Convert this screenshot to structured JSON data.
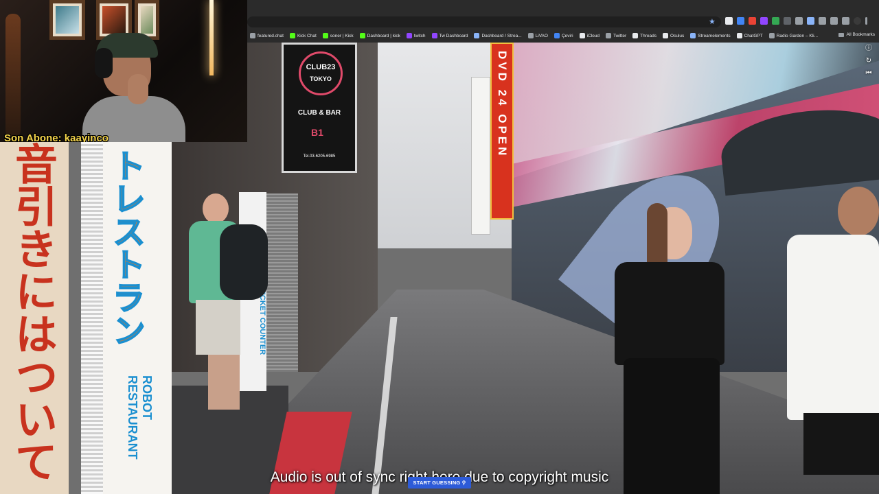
{
  "webcam": {
    "caption": "Son Abone: kaayinco"
  },
  "bookmarks": [
    {
      "label": "featured.chat",
      "color": "#9aa0a6"
    },
    {
      "label": "Kick Chat",
      "color": "#53fc18"
    },
    {
      "label": "soner | Kick",
      "color": "#53fc18"
    },
    {
      "label": "Dashboard | kick",
      "color": "#53fc18"
    },
    {
      "label": "twitch",
      "color": "#9146ff"
    },
    {
      "label": "Tw Dashboard",
      "color": "#9146ff"
    },
    {
      "label": "Dashboard / Strea...",
      "color": "#8ab4f8"
    },
    {
      "label": "LiVAO",
      "color": "#9aa0a6"
    },
    {
      "label": "Çeviri",
      "color": "#4285f4"
    },
    {
      "label": "iCloud",
      "color": "#e8eaed"
    },
    {
      "label": "Twitter",
      "color": "#9aa0a6"
    },
    {
      "label": "Threads",
      "color": "#e8eaed"
    },
    {
      "label": "Oculus",
      "color": "#e8eaed"
    },
    {
      "label": "Streamelements",
      "color": "#8ab4f8"
    },
    {
      "label": "ChatGPT",
      "color": "#e8eaed"
    },
    {
      "label": "Radio Garden – Kli...",
      "color": "#9aa0a6"
    }
  ],
  "bookmarks_all": "All Bookmarks",
  "scene": {
    "club_sign": {
      "name": "CLUB23",
      "city": "TOKYO",
      "subtitle": "CLUB & BAR",
      "floor": "B1",
      "phone": "Tel.03-6205-6985"
    },
    "dvd_sign": "DVD 24 OPEN",
    "left_banner": "音引きにはついて",
    "poster": "トレストラン",
    "poster_sub": "ROBOT RESTAURANT",
    "ticket_counter": "TICKET COUNTER"
  },
  "subtitle": "Audio is out of sync right here due to copyright music",
  "start_button": "START GUESSING ⚲",
  "icons": {
    "star": "★",
    "info": "ⓘ",
    "refresh": "↻",
    "skip": "⏮"
  }
}
